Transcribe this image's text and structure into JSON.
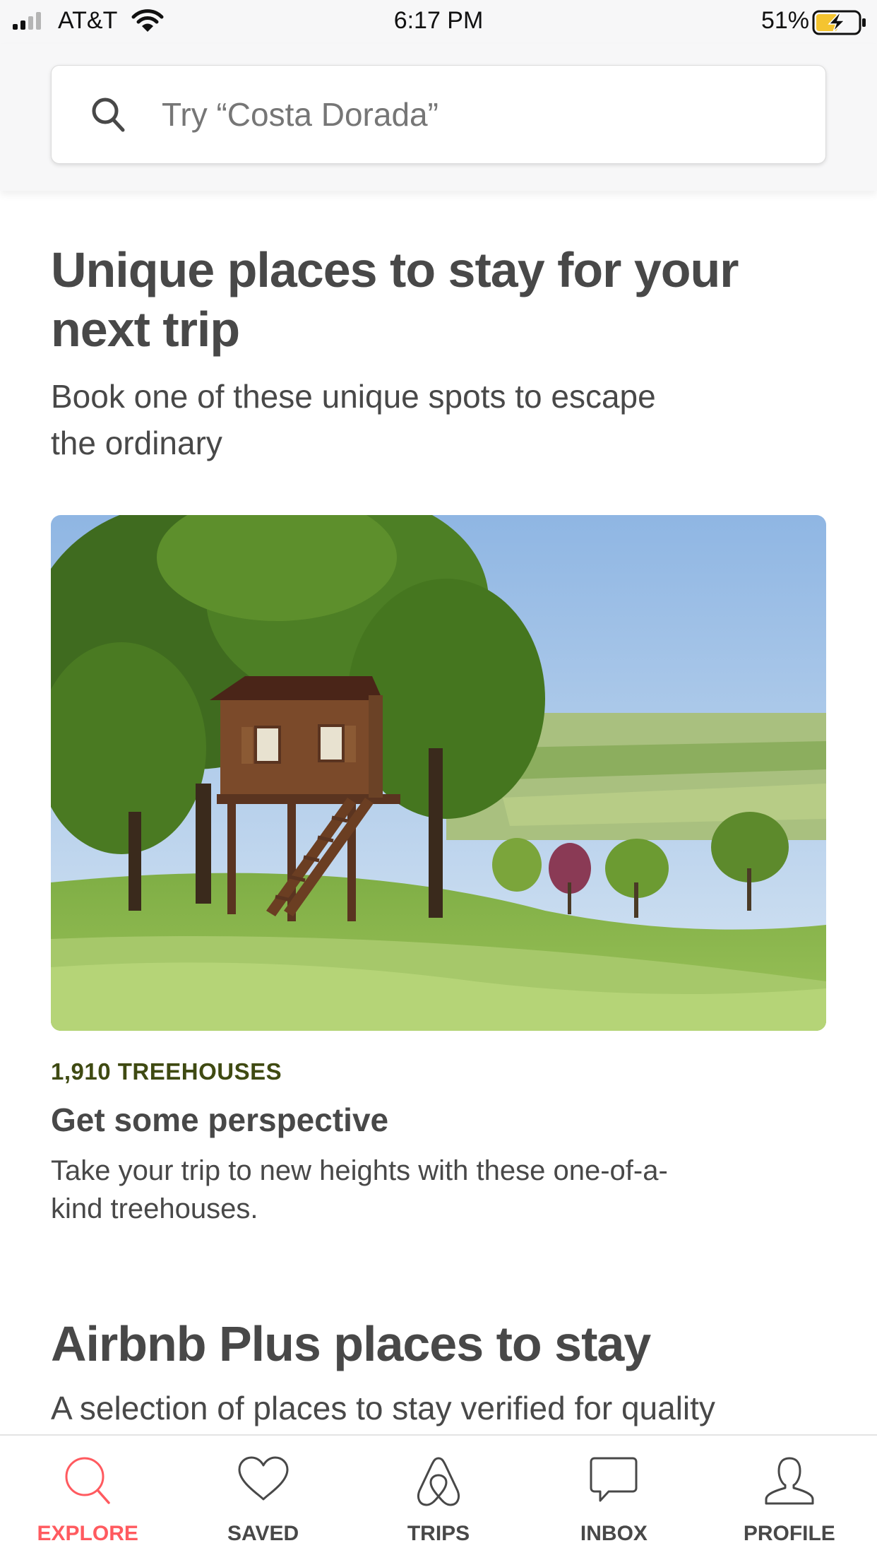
{
  "status_bar": {
    "carrier": "AT&T",
    "time": "6:17 PM",
    "battery_percent": "51%",
    "battery_level": 0.51,
    "charging": true
  },
  "search": {
    "placeholder": "Try “Costa Dorada”",
    "value": ""
  },
  "unique_section": {
    "title_line1": "Unique places to stay for your",
    "title_line2": "next trip",
    "subtitle_line1": "Book one of these unique spots to escape",
    "subtitle_line2": "the ordinary"
  },
  "treehouse_card": {
    "kicker": "1,910 TREEHOUSES",
    "title": "Get some perspective",
    "description_line1": "Take your trip to new heights with these one-of-a-",
    "description_line2": "kind treehouses."
  },
  "plus_section": {
    "title": "Airbnb Plus places to stay",
    "subtitle": "A selection of places to stay verified for quality"
  },
  "tab_bar": {
    "active": "explore",
    "tabs": [
      {
        "id": "explore",
        "label": "EXPLORE",
        "icon": "search-icon"
      },
      {
        "id": "saved",
        "label": "SAVED",
        "icon": "heart-icon"
      },
      {
        "id": "trips",
        "label": "TRIPS",
        "icon": "airbnb-logo-icon"
      },
      {
        "id": "inbox",
        "label": "INBOX",
        "icon": "chat-bubble-icon"
      },
      {
        "id": "profile",
        "label": "PROFILE",
        "icon": "person-icon"
      }
    ]
  },
  "colors": {
    "accent": "#FF5A5F",
    "text": "#484848",
    "kicker": "#3F4A12",
    "battery_charging": "#F4C430"
  }
}
